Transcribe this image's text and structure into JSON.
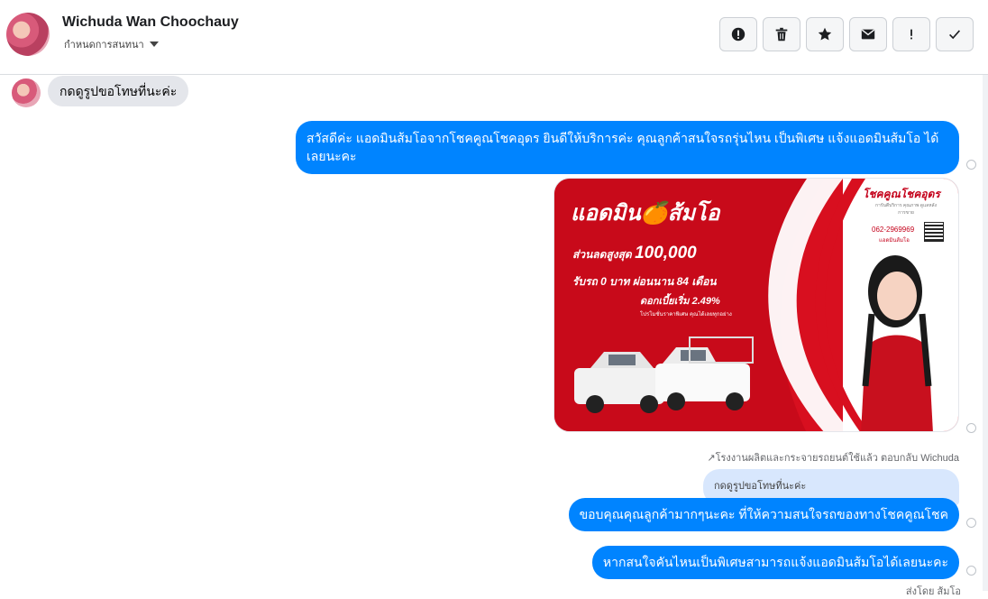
{
  "header": {
    "contact_name": "Wichuda Wan Choochauy",
    "subtitle": "กำหนดการสนทนา",
    "toolbar": [
      {
        "name": "report-button",
        "icon": "exclamation-circle-icon"
      },
      {
        "name": "delete-button",
        "icon": "trash-icon"
      },
      {
        "name": "star-button",
        "icon": "star-icon"
      },
      {
        "name": "mail-button",
        "icon": "envelope-icon"
      },
      {
        "name": "important-button",
        "icon": "exclamation-icon"
      },
      {
        "name": "done-button",
        "icon": "checkmark-icon"
      }
    ]
  },
  "messages": {
    "incoming_1": "กดดูรูปขอโทษที่นะค่ะ",
    "outgoing_1": "สวัสดีค่ะ แอดมินส้มโอจากโชคคูณโชคอุดร ยินดีให้บริการค่ะ  คุณลูกค้าสนใจรถรุ่นไหน เป็นพิเศษ แจ้งแอดมินส้มโอ ได้เลยนะคะ",
    "reply_meta": "โรงงานผลิตและกระจายรถยนต์ใช้แล้ว ตอบกลับ Wichuda",
    "quoted_text": "กดดูรูปขอโทษที่นะค่ะ",
    "outgoing_2": "ขอบคุณคุณลูกค้ามากๆนะคะ ที่ให้ความสนใจรถของทางโชคคูณโชค",
    "outgoing_3": "หากสนใจคันไหนเป็นพิเศษสามารถแจ้งแอดมินส้มโอได้เลยนะคะ",
    "bottom_meta": "ส่งโดย ส้มโอ"
  },
  "ad_image": {
    "headline": "แอดมิน🍊ส้มโอ",
    "line1_prefix": "ส่วนลดสูงสุด",
    "line1_amount": "100,000",
    "line2": "รับรถ 0 บาท ผ่อนนาน 84 เดือน",
    "line3": "ดอกเบี้ยเริ่ม 2.49%",
    "small_note": "โปรโมชั่นราคาพิเศษ คุณได้เลยทุกอย่าง",
    "brand": "โชคคูณโชคอุดร",
    "brand_sub": "การันตีบริการ คุณภาพ ดูแลหลังการขาย",
    "phone": "062-2969969",
    "staff_name": "แอดมินส้มโอ",
    "colors": {
      "primary_red": "#d80f1f",
      "dark_red": "#a8000f"
    }
  },
  "colors": {
    "outgoing_bubble": "#0084ff",
    "incoming_bubble": "#e4e6eb",
    "quoted_bubble": "#d8e7fd"
  }
}
